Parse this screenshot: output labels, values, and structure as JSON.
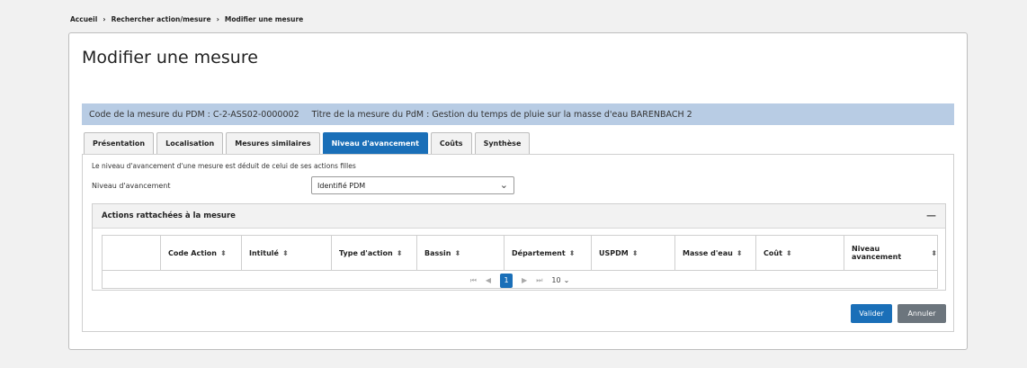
{
  "breadcrumb": {
    "items": [
      "Accueil",
      "Rechercher action/mesure",
      "Modifier une mesure"
    ],
    "separator": "›"
  },
  "page": {
    "title": "Modifier une mesure",
    "code_text": "Code de la mesure du PDM : C-2-ASS02-0000002",
    "titre_text": "Titre de la mesure du PdM : Gestion du temps de pluie sur la masse d'eau BARENBACH 2"
  },
  "tabs": [
    {
      "label": "Présentation",
      "active": false
    },
    {
      "label": "Localisation",
      "active": false
    },
    {
      "label": "Mesures similaires",
      "active": false
    },
    {
      "label": "Niveau d'avancement",
      "active": true
    },
    {
      "label": "Coûts",
      "active": false
    },
    {
      "label": "Synthèse",
      "active": false
    }
  ],
  "panel": {
    "note": "Le niveau d'avancement d'une mesure est déduit de celui de ses actions filles",
    "level_label": "Niveau d'avancement",
    "level_value": "Identifié PDM"
  },
  "actions": {
    "title": "Actions rattachées à la mesure",
    "collapse_glyph": "—",
    "columns": [
      "",
      "Code Action",
      "Intitulé",
      "Type d'action",
      "Bassin",
      "Département",
      "USPDM",
      "Masse d'eau",
      "Coût",
      "Niveau avancement"
    ],
    "pager": {
      "first": "⏮",
      "prev": "◀",
      "current": "1",
      "next": "▶",
      "last": "⏭",
      "page_size": "10"
    }
  },
  "buttons": {
    "valider": "Valider",
    "annuler": "Annuler"
  },
  "colors": {
    "accent": "#1a6fb8",
    "info_bar": "#b8cce4",
    "secondary_button": "#6c757d"
  }
}
